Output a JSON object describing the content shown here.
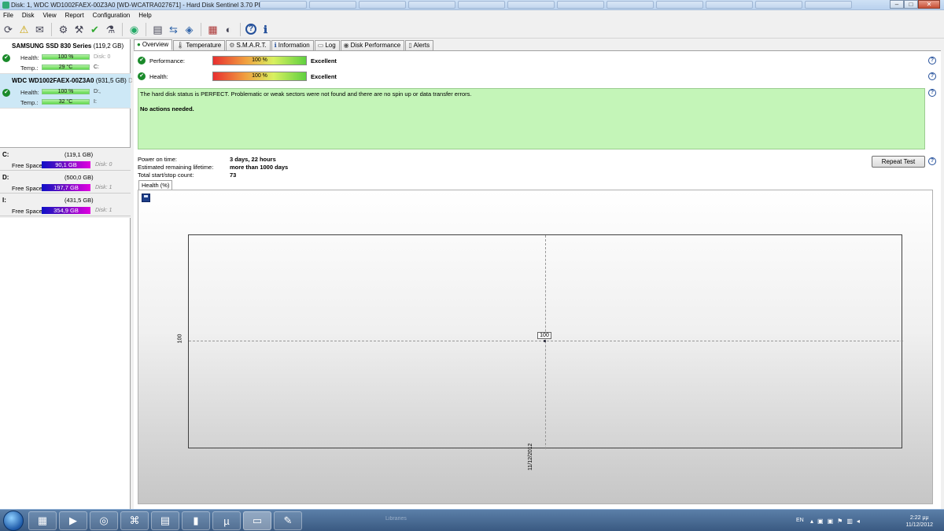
{
  "window": {
    "title": "Disk: 1, WDC WD1002FAEX-00Z3A0 [WD-WCATRA027671]  -  Hard Disk Sentinel 3.70 PRO",
    "min": "–",
    "max": "□",
    "close": "✕"
  },
  "menu": [
    "File",
    "Disk",
    "View",
    "Report",
    "Configuration",
    "Help"
  ],
  "toolbar": {
    "icons": [
      "refresh-icon",
      "alert-icon",
      "report-icon",
      "settings-icon",
      "tools-icon",
      "test-icon",
      "drive-icon",
      "globe-icon",
      "document-icon",
      "sync-icon",
      "network-icon",
      "chart-icon",
      "tune-icon",
      "help-icon",
      "info-icon"
    ],
    "help_glyph": "?",
    "info_glyph": "ℹ"
  },
  "disks": [
    {
      "name": "SAMSUNG SSD 830 Series",
      "size": "(119,2 GB)",
      "health_label": "Health:",
      "health": "100 %",
      "health_note": "Disk: 0",
      "temp_label": "Temp.:",
      "temp": "29 °C",
      "temp_note": "C:"
    },
    {
      "name": "WDC WD1002FAEX-00Z3A0",
      "size": "(931,5 GB)",
      "size_note": "Disk",
      "health_label": "Health:",
      "health": "100 %",
      "health_note": "D:,",
      "temp_label": "Temp.:",
      "temp": "32 °C",
      "temp_note": "I:"
    }
  ],
  "partitions": [
    {
      "drive": "C:",
      "size": "(119,1 GB)",
      "free_label": "Free Space",
      "free": "90,1 GB",
      "disk": "Disk: 0"
    },
    {
      "drive": "D:",
      "size": "(500,0 GB)",
      "free_label": "Free Space",
      "free": "197,7 GB",
      "disk": "Disk: 1"
    },
    {
      "drive": "I:",
      "size": "(431,5 GB)",
      "free_label": "Free Space",
      "free": "354,9 GB",
      "disk": "Disk: 1"
    }
  ],
  "tabs": [
    "Overview",
    "Temperature",
    "S.M.A.R.T.",
    "Information",
    "Log",
    "Disk Performance",
    "Alerts"
  ],
  "overview": {
    "performance_label": "Performance:",
    "performance_value": "100 %",
    "performance_result": "Excellent",
    "health_label": "Health:",
    "health_value": "100 %",
    "health_result": "Excellent",
    "status_line1": "The hard disk status is PERFECT. Problematic or weak sectors were not found and there are no spin up or data transfer errors.",
    "status_line2": "No actions needed.",
    "power_on_label": "Power on time:",
    "power_on_value": "3 days, 22 hours",
    "lifetime_label": "Estimated remaining lifetime:",
    "lifetime_value": "more than 1000 days",
    "startstop_label": "Total start/stop count:",
    "startstop_value": "73",
    "repeat_button": "Repeat Test",
    "graph_tab": "Health (%)"
  },
  "chart_data": {
    "type": "line",
    "title": "",
    "xlabel": "",
    "ylabel": "",
    "series": [
      {
        "x": [
          "11/12/2012"
        ],
        "values": [
          100
        ]
      }
    ],
    "y_ticks": [
      "100"
    ],
    "x_ticks": [
      "11/12/2012"
    ],
    "data_labels": [
      "100"
    ],
    "grid": true
  },
  "taskbar": {
    "apps": [
      "explorer-icon",
      "media-icon",
      "chrome-icon",
      "pdf-icon",
      "excel-icon",
      "app-icon",
      "torrent-icon",
      "hdsentinel-icon",
      "paint-icon"
    ],
    "lang": "EN",
    "time": "2:22 μμ",
    "date": "11/12/2012",
    "ghost": "Libraries"
  },
  "colors": {
    "status_bg": "#c4f5b8",
    "accent": "#234f9a",
    "ok": "#1a8a2a"
  }
}
